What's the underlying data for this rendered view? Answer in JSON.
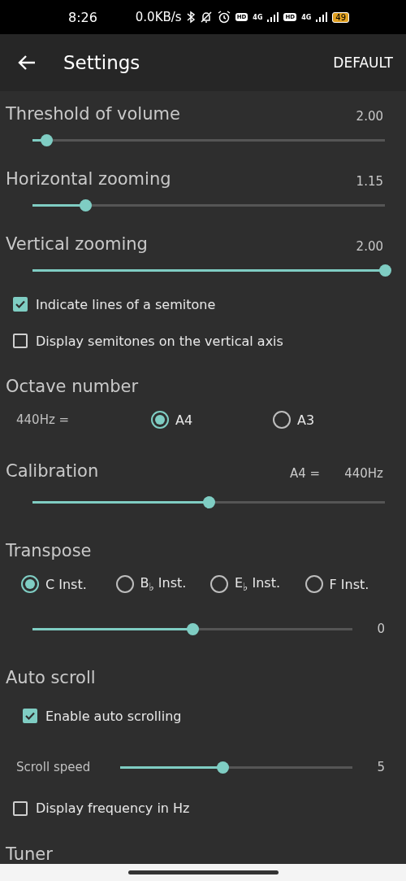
{
  "status_bar": {
    "time": "8:26",
    "network_speed": "0.0KB/s",
    "sims": [
      {
        "badge": "HD",
        "network": "4G"
      },
      {
        "badge": "HD",
        "network": "4G"
      }
    ],
    "battery": "49"
  },
  "app_bar": {
    "title": "Settings",
    "action": "DEFAULT"
  },
  "settings": [
    {
      "kind": "slider",
      "title": "Threshold of volume",
      "value": "2.00",
      "level": 0.04
    },
    {
      "kind": "slider",
      "title": "Horizontal zooming",
      "value": "1.15",
      "level": 0.15
    },
    {
      "kind": "slider",
      "title": "Vertical zooming",
      "value": "2.00",
      "level": 1.0
    },
    {
      "kind": "checkbox",
      "label": "Indicate lines of a semitone",
      "checked": true
    },
    {
      "kind": "checkbox",
      "label": "Display semitones on the vertical axis",
      "checked": false
    },
    {
      "kind": "group",
      "title": "Octave number",
      "children": [
        {
          "kind": "radios",
          "label": "440Hz =",
          "options": [
            {
              "label": "A4",
              "selected": true
            },
            {
              "label": "A3",
              "selected": false
            }
          ]
        }
      ]
    },
    {
      "kind": "group",
      "title": "Calibration",
      "notes": [
        "A4 =",
        "440Hz"
      ],
      "children": [
        {
          "kind": "track",
          "level": 0.5
        }
      ]
    },
    {
      "kind": "group",
      "title": "Transpose",
      "children": [
        {
          "kind": "radios",
          "options": [
            {
              "label": "C Inst.",
              "selected": true
            },
            {
              "label": "B$_{♭}$ Inst.",
              "selected": false
            },
            {
              "label": "E$_{♭}$ Inst.",
              "selected": false
            },
            {
              "label": "F Inst.",
              "selected": false
            }
          ]
        },
        {
          "kind": "track",
          "level": 0.5,
          "value": "0"
        }
      ]
    },
    {
      "kind": "group",
      "title": "Auto scroll",
      "children": [
        {
          "kind": "checkbox",
          "label": "Enable auto scrolling",
          "checked": true
        },
        {
          "kind": "track",
          "label": "Scroll speed",
          "level": 0.44,
          "value": "5"
        }
      ]
    },
    {
      "kind": "checkbox",
      "label": "Display frequency in Hz",
      "checked": false
    },
    {
      "kind": "group",
      "title": "Tuner"
    }
  ]
}
